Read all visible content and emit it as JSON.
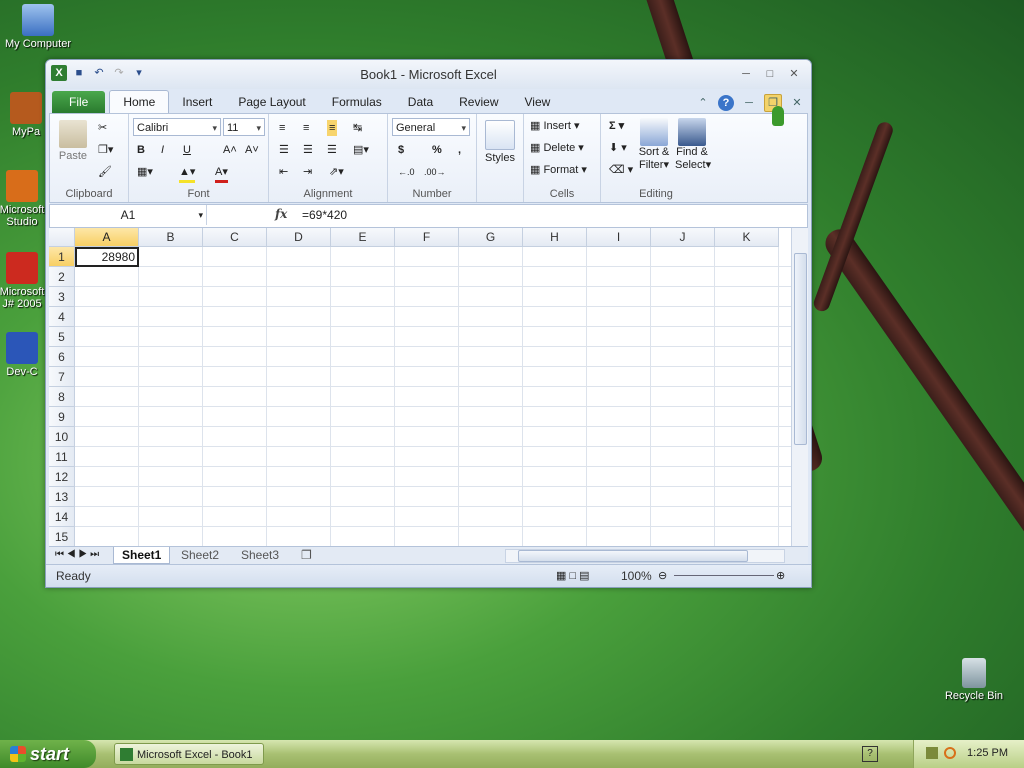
{
  "desktop": {
    "icons": [
      {
        "label": "My Computer"
      },
      {
        "label": "MyPa"
      },
      {
        "label": "Microsoft Studio"
      },
      {
        "label": "Microsoft J# 2005"
      },
      {
        "label": "Dev-C"
      },
      {
        "label": "Recycle Bin"
      }
    ]
  },
  "window": {
    "title": "Book1  -  Microsoft Excel",
    "tabs": [
      "File",
      "Home",
      "Insert",
      "Page Layout",
      "Formulas",
      "Data",
      "Review",
      "View"
    ],
    "active_tab": "Home"
  },
  "ribbon": {
    "clipboard": {
      "label": "Clipboard",
      "paste": "Paste"
    },
    "font": {
      "label": "Font",
      "name": "Calibri",
      "size": "11",
      "bold": "B",
      "italic": "I",
      "underline": "U"
    },
    "alignment": {
      "label": "Alignment"
    },
    "number": {
      "label": "Number",
      "format": "General",
      "currency": "$",
      "percent": "%",
      "comma": ","
    },
    "styles": {
      "label": "Styles"
    },
    "cells": {
      "label": "Cells",
      "insert": "Insert",
      "delete": "Delete",
      "format": "Format"
    },
    "editing": {
      "label": "Editing",
      "sort": "Sort &",
      "filter": "Filter",
      "find": "Find &",
      "select": "Select"
    }
  },
  "formula_bar": {
    "name_box": "A1",
    "fx": "fx",
    "formula": "=69*420"
  },
  "grid": {
    "columns": [
      "A",
      "B",
      "C",
      "D",
      "E",
      "F",
      "G",
      "H",
      "I",
      "J",
      "K"
    ],
    "rows": [
      "1",
      "2",
      "3",
      "4",
      "5",
      "6",
      "7",
      "8",
      "9",
      "10",
      "11",
      "12",
      "13",
      "14",
      "15"
    ],
    "cell_a1": "28980"
  },
  "sheets": {
    "tabs": [
      "Sheet1",
      "Sheet2",
      "Sheet3"
    ],
    "active": "Sheet1"
  },
  "status": {
    "text": "Ready",
    "zoom": "100%"
  },
  "taskbar": {
    "start": "start",
    "item": "Microsoft Excel - Book1",
    "clock": "1:25 PM"
  }
}
